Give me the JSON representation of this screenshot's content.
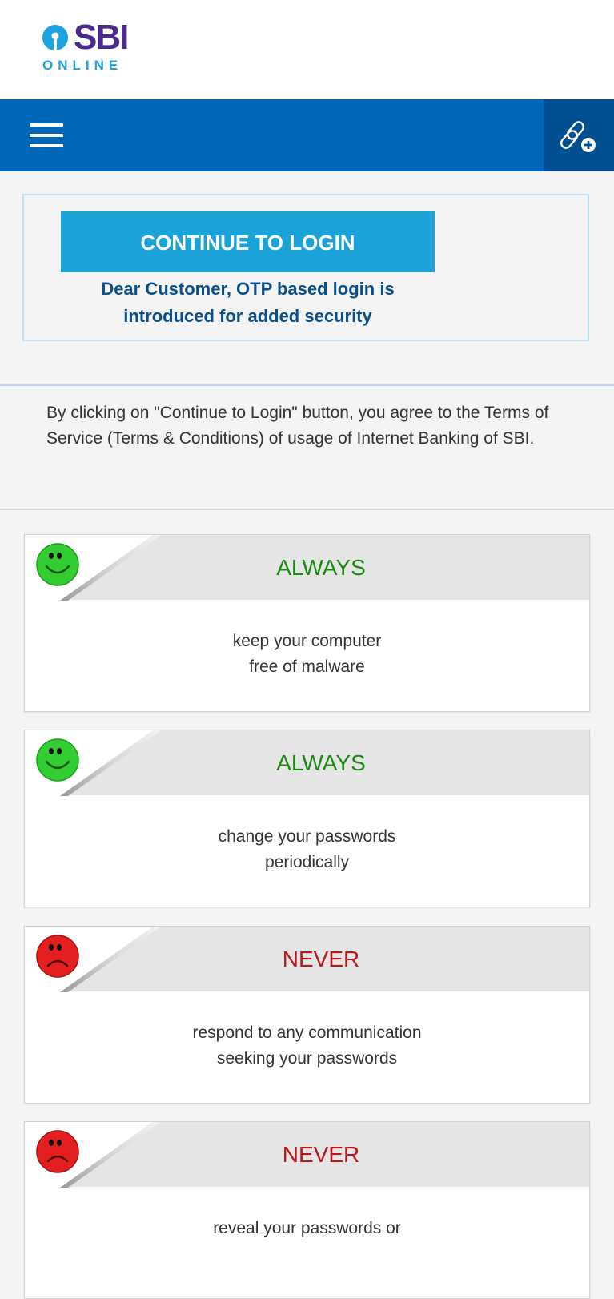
{
  "header": {
    "logo_main": "SBI",
    "logo_sub": "ONLINE",
    "icons": {
      "menu": "hamburger-menu-icon",
      "link": "link-add-icon"
    }
  },
  "login": {
    "button_label": "CONTINUE TO LOGIN",
    "note_line1": "Dear Customer, OTP based login is",
    "note_line2": "introduced for added security"
  },
  "terms": {
    "text": "By clicking on \"Continue to Login\" button, you agree to the Terms of Service (Terms & Conditions) of usage of Internet Banking of SBI."
  },
  "tips": [
    {
      "title": "ALWAYS",
      "kind": "always",
      "icon": "smiley-face-icon",
      "line1": "keep your computer",
      "line2": "free of malware"
    },
    {
      "title": "ALWAYS",
      "kind": "always",
      "icon": "smiley-face-icon",
      "line1": "change your passwords",
      "line2": "periodically"
    },
    {
      "title": "NEVER",
      "kind": "never",
      "icon": "sad-face-icon",
      "line1": "respond to any communication",
      "line2": "seeking your passwords"
    },
    {
      "title": "NEVER",
      "kind": "never",
      "icon": "sad-face-icon",
      "line1": "reveal your passwords or",
      "line2": ""
    }
  ],
  "colors": {
    "nav_blue": "#0066b8",
    "button_blue": "#1ba3d8",
    "always_green": "#1a8a12",
    "never_red": "#c0161b"
  }
}
